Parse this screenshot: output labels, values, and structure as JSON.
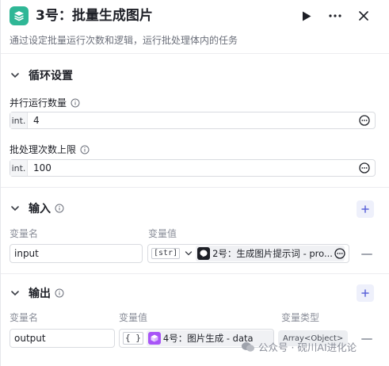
{
  "header": {
    "title": "3号：批量生成图片",
    "description": "通过设定批量运行次数和逻辑，运行批处理体内的任务",
    "icon": "layers-icon",
    "accent": "#2fb796"
  },
  "loop_settings": {
    "section_label": "循环设置",
    "parallel": {
      "label": "并行运行数量",
      "prefix": "int.",
      "value": "4"
    },
    "batch_limit": {
      "label": "批处理次数上限",
      "prefix": "int.",
      "value": "100"
    }
  },
  "input_section": {
    "section_label": "输入",
    "col_name": "变量名",
    "col_value": "变量值",
    "rows": [
      {
        "name": "input",
        "type_tag": "[str]",
        "ref_label": "2号：生成图片提示词 - pro..."
      }
    ]
  },
  "output_section": {
    "section_label": "输出",
    "col_name": "变量名",
    "col_value": "变量值",
    "col_type": "变量类型",
    "rows": [
      {
        "name": "output",
        "type_tag": "{ }",
        "ref_label": "4号：图片生成 - data",
        "var_type": "Array<Object>"
      }
    ]
  },
  "watermark": "公众号 · 砚川AI进化论",
  "colors": {
    "add_button": "#5b63d9",
    "chip_icon_output": "#a855f7"
  }
}
